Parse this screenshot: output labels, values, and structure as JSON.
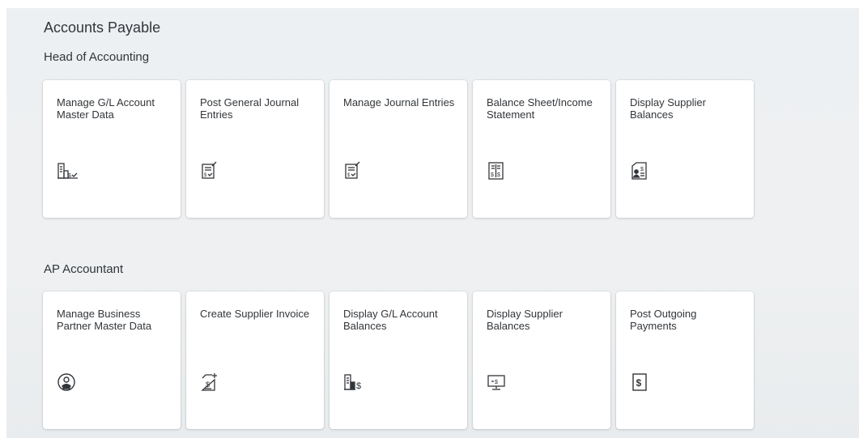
{
  "page": {
    "title": "Accounts Payable"
  },
  "groups": [
    {
      "title": "Head of Accounting",
      "tiles": [
        {
          "title": "Manage G/L Account Master Data",
          "icon": "building-dollar-check-icon"
        },
        {
          "title": "Post General Journal Entries",
          "icon": "journal-entry-icon"
        },
        {
          "title": "Manage Journal Entries",
          "icon": "journal-entry-icon"
        },
        {
          "title": "Balance Sheet/Income Statement",
          "icon": "balance-sheet-icon"
        },
        {
          "title": "Display Supplier Balances",
          "icon": "supplier-balance-icon"
        }
      ]
    },
    {
      "title": "AP Accountant",
      "tiles": [
        {
          "title": "Manage Business Partner Master Data",
          "icon": "business-partner-icon"
        },
        {
          "title": "Create Supplier Invoice",
          "icon": "create-invoice-icon"
        },
        {
          "title": "Display G/L Account Balances",
          "icon": "building-dollar-icon"
        },
        {
          "title": "Display Supplier Balances",
          "icon": "monitor-dollar-icon"
        },
        {
          "title": "Post Outgoing Payments",
          "icon": "outgoing-payment-icon"
        }
      ]
    }
  ],
  "icon_color": "#32363a",
  "background_color": "#edf0f2"
}
